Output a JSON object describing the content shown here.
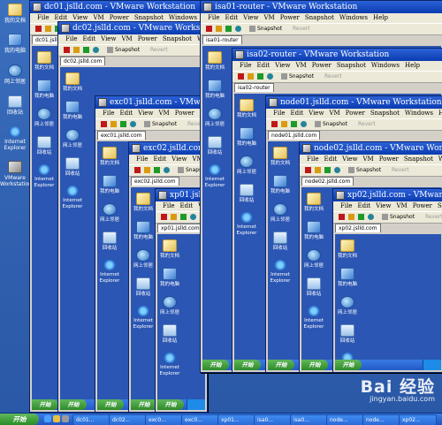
{
  "desktop": {
    "icons": [
      {
        "label": "我的文档",
        "icon": "documents-icon"
      },
      {
        "label": "我的电脑",
        "icon": "computer-icon"
      },
      {
        "label": "网上邻居",
        "icon": "network-icon"
      },
      {
        "label": "回收站",
        "icon": "recycle-bin-icon"
      },
      {
        "label": "Internet Explorer",
        "icon": "ie-icon"
      },
      {
        "label": "VMware Workstation",
        "icon": "vmware-icon"
      }
    ]
  },
  "vm_menu": [
    "File",
    "Edit",
    "View",
    "VM",
    "Power",
    "Snapshot",
    "Windows",
    "Help"
  ],
  "toolbar": {
    "snapshot_label": "Snapshot",
    "revert_label": "Revert"
  },
  "guest_icons": [
    "我的文档",
    "我的电脑",
    "网上邻居",
    "回收站",
    "Internet Explorer"
  ],
  "guest_start_label": "开始",
  "windows": [
    {
      "title": "dc01.jslld.com - VMware Workstation",
      "tab": "dc01.jslld.com"
    },
    {
      "title": "dc02.jslld.com - VMware Workstation",
      "tab": "dc02.jslld.com"
    },
    {
      "title": "exc01.jslld.com - VMware Workstation",
      "tab": "exc01.jslld.com"
    },
    {
      "title": "exc02.jslld.com - VMware Workstation",
      "tab": "exc02.jslld.com"
    },
    {
      "title": "xp01.jslld.com - VMware Workstation",
      "tab": "xp01.jslld.com"
    },
    {
      "title": "isa01-router - VMware Workstation",
      "tab": "isa01-router"
    },
    {
      "title": "isa02-router - VMware Workstation",
      "tab": "isa02-router"
    },
    {
      "title": "node01.jslld.com - VMware Workstation",
      "tab": "node01.jslld.com"
    },
    {
      "title": "node02.jslld.com - VMware Workstation",
      "tab": "node02.jslld.com"
    },
    {
      "title": "xp02.jslld.com - VMware Workstation",
      "tab": "xp02.jslld.com"
    }
  ],
  "taskbar": {
    "start_label": "开始",
    "buttons": [
      "dc01...",
      "dc02...",
      "exc0...",
      "exc0...",
      "xp01...",
      "isa0...",
      "isa0...",
      "node...",
      "node...",
      "xp02..."
    ]
  },
  "watermark": {
    "brand": "Bai 经验",
    "url": "jingyan.baidu.com"
  }
}
